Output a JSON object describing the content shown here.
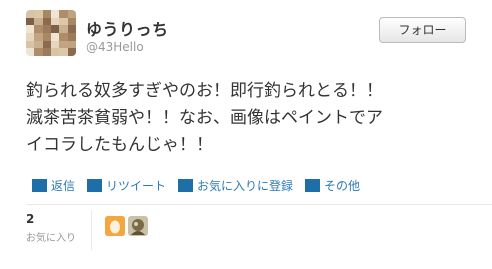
{
  "user": {
    "display_name": "ゆうりっち",
    "screen_name": "@43Hello",
    "avatar_icon": "pixelated-avatar-icon"
  },
  "follow_button": {
    "label": "フォロー"
  },
  "tweet": {
    "lines": [
      "釣られる奴多すぎやのお！即行釣られとる！！",
      "滅茶苦茶貧弱や！！なお、画像はペイントでア",
      "イコラしたもんじゃ！！"
    ]
  },
  "actions": [
    {
      "label": "返信",
      "icon": "reply-icon"
    },
    {
      "label": "リツイート",
      "icon": "retweet-icon"
    },
    {
      "label": "お気に入りに登録",
      "icon": "favorite-icon"
    },
    {
      "label": "その他",
      "icon": "more-icon"
    }
  ],
  "stats": {
    "favorites_count": "2",
    "favorites_label": "お気に入り"
  },
  "colors": {
    "link": "#2b7bb9",
    "action_icon": "#1e6fa8",
    "muted": "#999999"
  }
}
